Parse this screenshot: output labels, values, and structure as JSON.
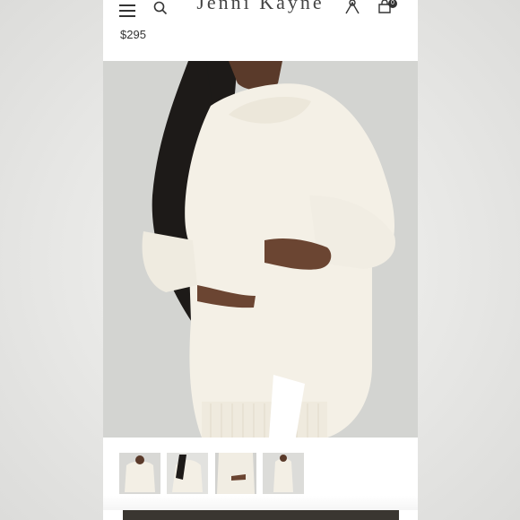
{
  "header": {
    "brand": "Jenni Kayne",
    "cart_count": "0"
  },
  "product": {
    "price": "$295"
  },
  "icons": {
    "menu": "hamburger-menu-icon",
    "search": "search-icon",
    "account": "account-icon",
    "bag": "shopping-bag-icon"
  },
  "colors": {
    "cta": "#3a3631",
    "text": "#333333"
  },
  "gallery": {
    "thumbnail_count": 4
  }
}
